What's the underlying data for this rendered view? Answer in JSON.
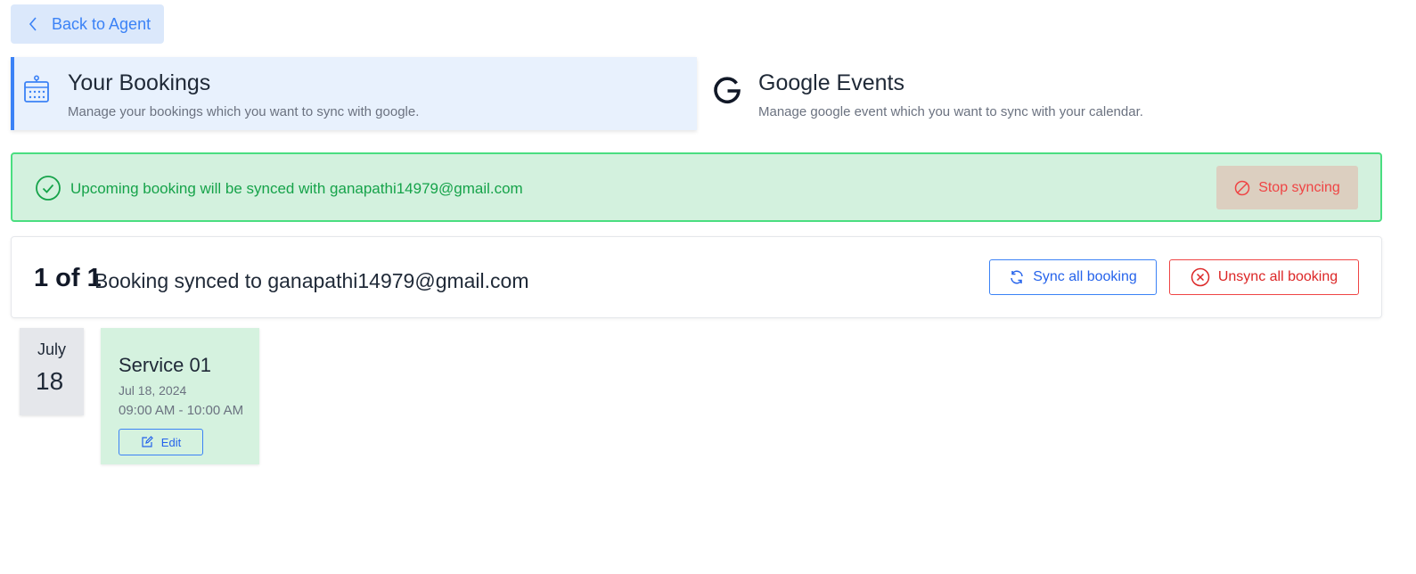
{
  "nav": {
    "back_label": "Back to Agent"
  },
  "tabs": [
    {
      "title": "Your Bookings",
      "description": "Manage your bookings which you want to sync with google.",
      "icon": "calendar-icon",
      "active": true
    },
    {
      "title": "Google Events",
      "description": "Manage google event which you want to sync with your calendar.",
      "icon": "google-logo-icon",
      "active": false
    }
  ],
  "sync_alert": {
    "message": "Upcoming booking will be synced with ganapathi14979@gmail.com",
    "stop_label": "Stop syncing",
    "icon": "check-circle-icon"
  },
  "summary": {
    "count": "1 of 1",
    "text": "Booking synced to ganapathi14979@gmail.com",
    "sync_all_label": "Sync all booking",
    "unsync_all_label": "Unsync all booking"
  },
  "bookings": [
    {
      "month": "July",
      "day": "18",
      "service": "Service 01",
      "date": "Jul 18, 2024",
      "time": "09:00 AM - 10:00 AM",
      "edit_label": "Edit"
    }
  ],
  "colors": {
    "accent": "#3b82f6",
    "success": "#16a34a",
    "danger": "#ef4444",
    "active_tab_bg": "#e8f1fd",
    "alert_bg": "#d3f1de",
    "card_bg": "#d5f2df"
  }
}
